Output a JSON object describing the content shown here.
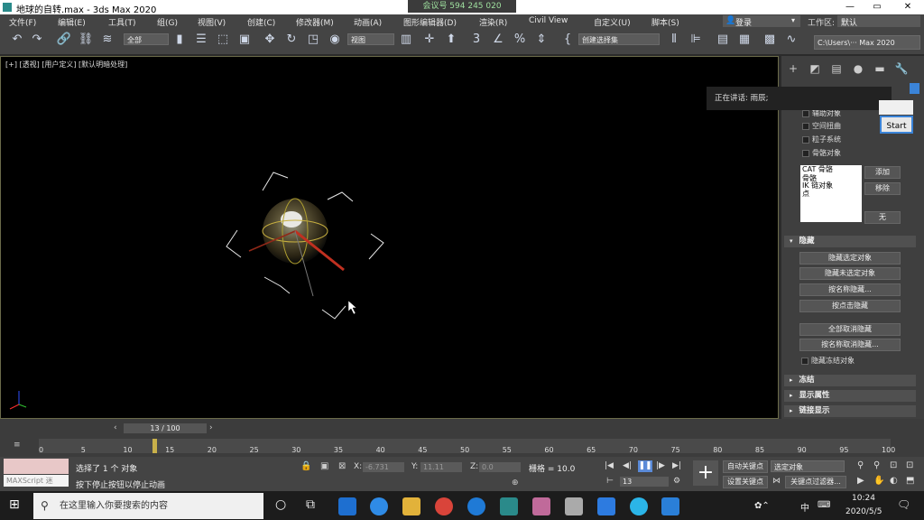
{
  "window": {
    "title": "地球的自转.max - 3ds Max 2020",
    "meeting": "会议号 594 245 020",
    "minimize": "—",
    "restore": "▭",
    "close": "✕"
  },
  "menu": [
    "文件(F)",
    "编辑(E)",
    "工具(T)",
    "组(G)",
    "视图(V)",
    "创建(C)",
    "修改器(M)",
    "动画(A)",
    "图形编辑器(D)",
    "渲染(R)",
    "Civil View",
    "自定义(U)",
    "脚本(S)"
  ],
  "login": "登录",
  "workspace": {
    "label": "工作区:",
    "value": "默认"
  },
  "toolbar": {
    "filter": "全部",
    "view": "视图",
    "selection_set": "创建选择集",
    "path": "C:\\Users\\··· Max 2020"
  },
  "viewport": {
    "label": "[+] [透视] [用户定义] [默认明暗处理]"
  },
  "tooltip": "正在讲话: 雨辰;",
  "start": "Start",
  "panel": {
    "checks_top": [
      "辅助对象",
      "空间扭曲",
      "粒子系统",
      "骨骼对象"
    ],
    "list": [
      "CAT 骨骼",
      "骨骼",
      "IK 链对象",
      "点"
    ],
    "list_buttons": [
      "添加",
      "移除",
      "无"
    ],
    "hide_section": "隐藏",
    "hide_buttons": [
      "隐藏选定对象",
      "隐藏未选定对象",
      "按名称隐藏...",
      "按点击隐藏",
      "全部取消隐藏",
      "按名称取消隐藏..."
    ],
    "hide_frozen": "隐藏冻结对象",
    "sections": [
      "冻结",
      "显示属性",
      "链接显示"
    ]
  },
  "timeline": {
    "frame": "13 / 100",
    "ticks": [
      "0",
      "5",
      "10",
      "15",
      "20",
      "25",
      "30",
      "35",
      "40",
      "45",
      "50",
      "55",
      "60",
      "65",
      "70",
      "75",
      "80",
      "85",
      "90",
      "95",
      "100"
    ]
  },
  "status": {
    "maxscript": "MAXScript 迷",
    "selected": "选择了 1 个 对象",
    "hint": "按下停止按钮以停止动画",
    "x_label": "X:",
    "x": "-6.731",
    "y_label": "Y:",
    "y": "11.11",
    "z_label": "Z:",
    "z": "0.0",
    "grid": "栅格 = 10.0",
    "frame_value": "13",
    "autokey": "自动关键点",
    "setkey": "设置关键点",
    "selected_object": "选定对象",
    "key_filter": "关键点过滤器..."
  },
  "taskbar": {
    "search": "在这里输入你要搜索的内容",
    "time": "10:24",
    "date": "2020/5/5",
    "ime": "中"
  }
}
